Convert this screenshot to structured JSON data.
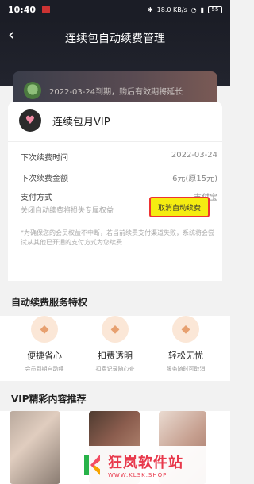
{
  "status_bar": {
    "time": "10:40",
    "right_text": "18.0 KB/s",
    "battery": "55"
  },
  "header": {
    "title": "连续包自动续费管理",
    "member_card": {
      "expiry_text": "2022-03-24到期，购后有效期将延长"
    }
  },
  "subscription": {
    "name": "连续包月VIP",
    "rows": [
      {
        "label": "下次续费时间",
        "value": "2022-03-24"
      },
      {
        "label": "下次续费金额",
        "value": "6元",
        "original": "(原15元)"
      },
      {
        "label": "支付方式",
        "value": "支付宝"
      }
    ],
    "cancel_hint": "关闭自动续费将损失专属权益",
    "cancel_button": "取消自动续费",
    "notice": "*为确保您的会员权益不中断，若当前续费支付渠道失败，系统将会尝试从其他已开通的支付方式为您续费"
  },
  "privileges": {
    "title": "自动续费服务特权",
    "items": [
      {
        "name": "便捷省心",
        "desc": "会员到期自动续",
        "icon": "shield-icon"
      },
      {
        "name": "扣费透明",
        "desc": "扣费记录随心查",
        "icon": "shield-icon"
      },
      {
        "name": "轻松无忧",
        "desc": "服务随时可取消",
        "icon": "shield-icon"
      }
    ]
  },
  "recommendations": {
    "title": "VIP精彩内容推荐"
  },
  "watermark": {
    "title": "狂岚软件站",
    "url": "WWW.KLSK.SHOP"
  },
  "colors": {
    "header_bg": "#1b1d26",
    "cancel_button_bg": "#f5ec11",
    "highlight_border": "#e33",
    "privilege_icon": "#e7a06f",
    "watermark_red": "#e8394c",
    "watermark_green": "#28b34a"
  }
}
